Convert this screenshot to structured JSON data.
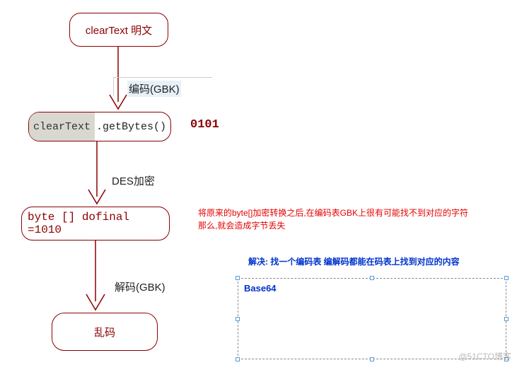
{
  "nodes": {
    "n1": "clearText 明文",
    "n2_hl": "clearText",
    "n2_rest": ".getBytes()",
    "binary1": "0101",
    "n3": "byte [] dofinal =1010",
    "n4": "乱码"
  },
  "edges": {
    "e1": "编码(GBK)",
    "e2": "DES加密",
    "e3": "解码(GBK)"
  },
  "annotations": {
    "red_line1": "将原来的byte[]加密转换之后,在编码表GBK上很有可能找不到对应的字符",
    "red_line2": "那么,就会造成字节丢失",
    "blue": "解决: 找一个编码表    编解码都能在码表上找到对应的内容",
    "solution": "Base64"
  },
  "watermark": "@51CTO博客"
}
